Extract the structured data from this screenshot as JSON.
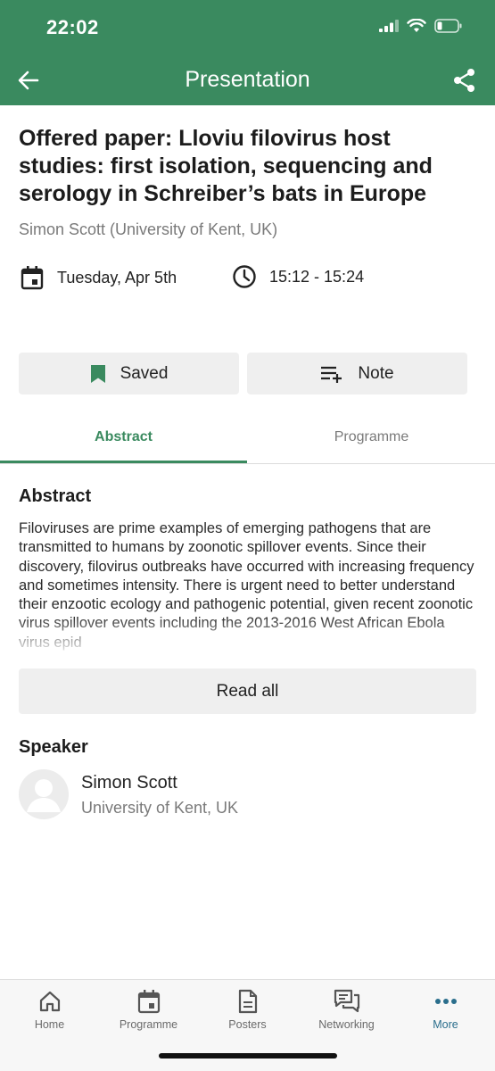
{
  "status": {
    "time": "22:02"
  },
  "header": {
    "title": "Presentation"
  },
  "presentation": {
    "title": "Offered paper: Lloviu filovirus host studies: first isolation, sequencing and serology in Schreiber’s bats in Europe",
    "author": "Simon Scott (University of Kent, UK)",
    "date": "Tuesday, Apr 5th",
    "time": "15:12 - 15:24"
  },
  "actions": {
    "saved_label": "Saved",
    "note_label": "Note"
  },
  "tabs": [
    {
      "label": "Abstract",
      "active": true
    },
    {
      "label": "Programme",
      "active": false
    }
  ],
  "abstract": {
    "heading": "Abstract",
    "text": "Filoviruses are prime examples of emerging pathogens that are transmitted to humans by zoonotic spillover events. Since their discovery, filovirus outbreaks have occurred with increasing frequency and sometimes intensity. There is urgent need to better understand their enzootic ecology and pathogenic potential, given recent zoonotic virus spillover events including the 2013-2016 West African Ebola virus epid",
    "read_all_label": "Read all"
  },
  "speaker": {
    "heading": "Speaker",
    "name": "Simon Scott",
    "org": "University of Kent, UK"
  },
  "nav": [
    {
      "label": "Home",
      "icon": "home-icon",
      "active": false
    },
    {
      "label": "Programme",
      "icon": "calendar-icon",
      "active": false
    },
    {
      "label": "Posters",
      "icon": "document-icon",
      "active": false
    },
    {
      "label": "Networking",
      "icon": "chat-icon",
      "active": false
    },
    {
      "label": "More",
      "icon": "more-dots-icon",
      "active": true
    }
  ],
  "colors": {
    "brand": "#3a8a5f",
    "nav_active": "#2a6e8c",
    "saved_icon": "#3a8a5f"
  }
}
